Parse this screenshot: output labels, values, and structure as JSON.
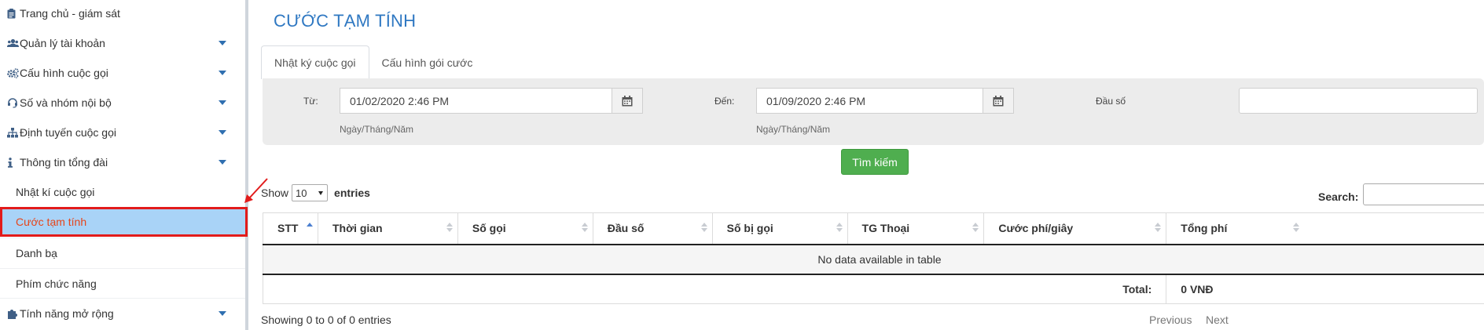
{
  "sidebar": {
    "items": [
      {
        "label": "Trang chủ - giám sát",
        "icon": "clipboard-icon",
        "caret": false
      },
      {
        "label": "Quản lý tài khoản",
        "icon": "users-icon",
        "caret": true
      },
      {
        "label": "Cấu hình cuộc gọi",
        "icon": "cogs-icon",
        "caret": true
      },
      {
        "label": "Số và nhóm nội bộ",
        "icon": "headset-icon",
        "caret": true
      },
      {
        "label": "Định tuyến cuộc gọi",
        "icon": "sitemap-icon",
        "caret": true
      },
      {
        "label": "Thông tin tổng đài",
        "icon": "info-icon",
        "caret": true
      }
    ],
    "sub_items": [
      {
        "label": "Nhật kí cuộc gọi"
      },
      {
        "label": "Cước tạm tính",
        "active": true
      },
      {
        "label": "Danh bạ"
      },
      {
        "label": "Phím chức năng"
      }
    ],
    "extra": {
      "label": "Tính năng mở rộng",
      "icon": "puzzle-icon"
    }
  },
  "main": {
    "title": "CƯỚC TẠM TÍNH",
    "tabs": [
      {
        "label": "Nhật ký cuộc gọi",
        "active": true
      },
      {
        "label": "Cấu hình gói cước",
        "active": false
      }
    ],
    "filter": {
      "from_label": "Từ:",
      "from_value": "01/02/2020 2:46 PM",
      "to_label": "Đến:",
      "to_value": "01/09/2020 2:46 PM",
      "prefix_label": "Đầu số",
      "prefix_value": "",
      "date_hint": "Ngày/Tháng/Năm"
    },
    "search_button": "Tìm kiếm",
    "table": {
      "show_label": "Show",
      "page_size": "10",
      "entries_label": "entries",
      "search_label": "Search:",
      "search_value": "",
      "columns": [
        "STT",
        "Thời gian",
        "Số gọi",
        "Đầu số",
        "Số bị gọi",
        "TG Thoại",
        "Cước phí/giây",
        "Tổng phí"
      ],
      "empty_message": "No data available in table",
      "total_label": "Total:",
      "total_value": "0 VNĐ",
      "info": "Showing 0 to 0 of 0 entries",
      "prev": "Previous",
      "next": "Next"
    }
  },
  "colors": {
    "accent": "#2f78c2",
    "active_bg": "#a9d3f7",
    "active_text": "#e6451a",
    "highlight_border": "#e21b1b",
    "button_green": "#4fae4f"
  }
}
